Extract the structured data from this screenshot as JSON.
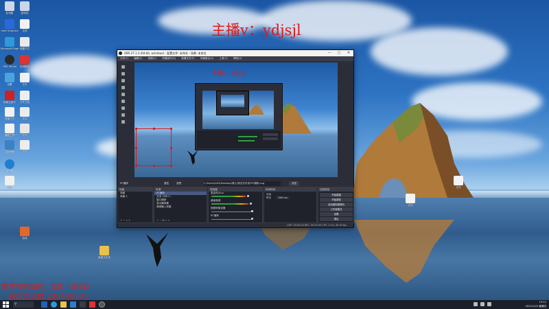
{
  "watermarks": {
    "top": "主播v：ydjsjl",
    "preview": "主播v：ydjsjl",
    "bottom_line1": "教学视频B站：年迈上单YD",
    "bottom_line2": "粉丝交流群:230459531"
  },
  "desktop_icons": [
    {
      "label": "此电脑",
      "icon": "computer-icon",
      "color": "#cfd8e6"
    },
    {
      "label": "回收站",
      "icon": "recycle-bin-icon",
      "color": "#c9d7e8"
    },
    {
      "label": "Intel Graphics",
      "icon": "intel-icon",
      "color": "#2a6ad8"
    },
    {
      "label": "文档",
      "icon": "document-icon",
      "color": "#f2f2f2"
    },
    {
      "label": "Microsoft Edge",
      "icon": "edge-icon",
      "color": "#2f9ad8"
    },
    {
      "label": "快捷方式",
      "icon": "shortcut-icon",
      "color": "#e9e9e9"
    },
    {
      "label": "OBS Studio",
      "icon": "obs-icon",
      "color": "#2b2b2b"
    },
    {
      "label": "应用程序",
      "icon": "app-icon",
      "color": "#d33"
    },
    {
      "label": "设置",
      "icon": "settings-icon",
      "color": "#4aa3df"
    },
    {
      "label": "文件",
      "icon": "file-icon",
      "color": "#f0f0f0"
    },
    {
      "label": "网易云音乐",
      "icon": "music-icon",
      "color": "#c22"
    },
    {
      "label": "文本文档",
      "icon": "text-file-icon",
      "color": "#eeeeee"
    },
    {
      "label": "快捷方式",
      "icon": "shortcut-icon",
      "color": "#f1f1f1"
    },
    {
      "label": "文件",
      "icon": "file-icon",
      "color": "#ececec"
    },
    {
      "label": "截图工具",
      "icon": "snip-icon",
      "color": "#f2f2f2"
    },
    {
      "label": "文件",
      "icon": "file-icon",
      "color": "#e6e6e6"
    },
    {
      "label": "控制面板",
      "icon": "control-panel-icon",
      "color": "#3b82c4"
    },
    {
      "label": "文件",
      "icon": "file-icon",
      "color": "#ededed"
    },
    {
      "label": "浏览器",
      "icon": "browser-icon",
      "color": "#1f7fd0"
    },
    {
      "label": "文件",
      "icon": "file-icon",
      "color": "#f0f0f0"
    },
    {
      "label": "游戏",
      "icon": "game-icon",
      "color": "#e2672a"
    },
    {
      "label": "新建文件夹",
      "icon": "folder-icon",
      "color": "#e9c24a"
    },
    {
      "label": "文件",
      "icon": "file-icon",
      "color": "#f3f3f3"
    },
    {
      "label": "文件",
      "icon": "file-icon",
      "color": "#f3f3f3"
    }
  ],
  "obs": {
    "title": "OBS 27.1.3 (64-bit, windows) - 配置文件: 未命名 - 场景: 未命名",
    "menu": [
      "文件(F)",
      "编辑(E)",
      "视图(V)",
      "停靠部件(D)",
      "配置文件(P)",
      "场景集合(S)",
      "工具(T)",
      "帮助(H)"
    ],
    "audio_row": {
      "device": "PC捕获",
      "settings": "属性",
      "filters": "滤镜",
      "path": "C:/Users/XXX/Desktop/博士/测试文件夹/PC捕获.png",
      "browse": "浏览"
    },
    "scenes_header": "场景",
    "scenes": [
      "场景",
      "场景 2"
    ],
    "sources_header": "来源",
    "sources": [
      "PC捕获",
      "文本 (GDI+)",
      "窗口捕获",
      "显示器采集",
      "音频输入采集"
    ],
    "mixer_header": "混音器",
    "mixer": [
      "麦克风/Aux",
      "桌面音频",
      "视频采集设备",
      "PC捕获"
    ],
    "props_header": "转场特效",
    "props": [
      {
        "label": "淡出",
        "value": ""
      },
      {
        "label": "时长",
        "value": "300 ms"
      }
    ],
    "controls_header": "控制按钮",
    "controls": [
      "开始直播",
      "开始录制",
      "启动虚拟摄像机",
      "工作室模式",
      "设置",
      "退出"
    ],
    "status": "LIVE: 00:00:00   REC: 00:00:00   CPU: 3.2%, 60.00 fps"
  },
  "taskbar": {
    "time": "19:11",
    "date": "2022/1/20 星期四"
  }
}
